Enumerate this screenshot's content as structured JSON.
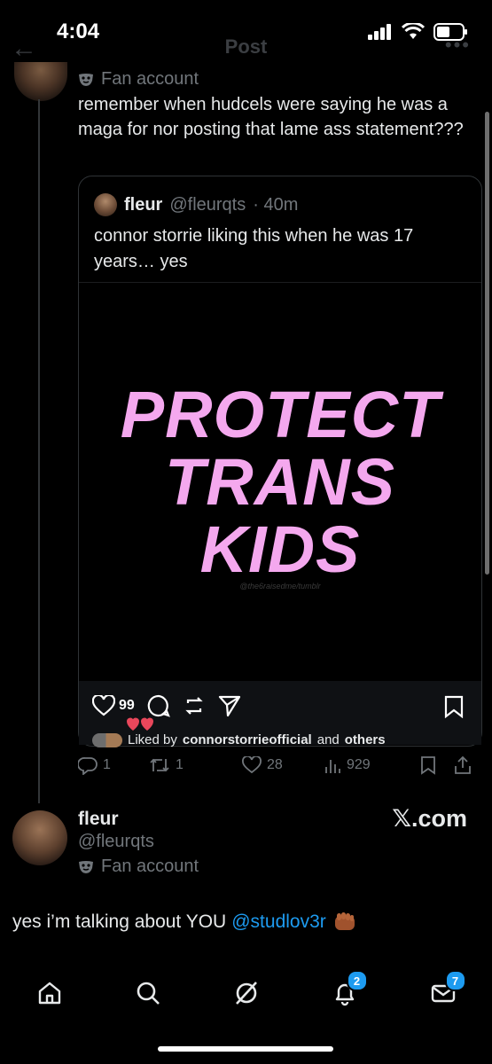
{
  "status_bar": {
    "time": "4:04"
  },
  "nav": {
    "title": "Post"
  },
  "post": {
    "badge_label": "Fan account",
    "text": "remember when hudcels were saying he was a maga for nor posting that lame ass statement???"
  },
  "quote": {
    "name": "fleur",
    "handle": "@fleurqts",
    "time": "· 40m",
    "text": "connor storrie liking this when he was 17 years… yes",
    "image_lines": [
      "PROTECT",
      "TRANS",
      "KIDS"
    ],
    "watermark": "@the6raisedme/tumblr",
    "likes_count": "99",
    "liked_by_prefix": "Liked by",
    "liked_by_user": "connorstorrieofficial",
    "liked_by_and": "and",
    "liked_by_others": "others"
  },
  "actions": {
    "replies": "1",
    "reposts": "1",
    "likes": "28",
    "views": "929"
  },
  "author": {
    "name": "fleur",
    "handle": "@fleurqts",
    "badge_label": "Fan account",
    "source": "𝕏.com"
  },
  "main": {
    "text": "yes i’m talking about YOU",
    "mention": "@studlov3r"
  },
  "tabs": {
    "notifications_badge": "2",
    "messages_badge": "7"
  },
  "colors": {
    "accent": "#1d9bf0",
    "poster_pink": "#f4a8ee"
  }
}
